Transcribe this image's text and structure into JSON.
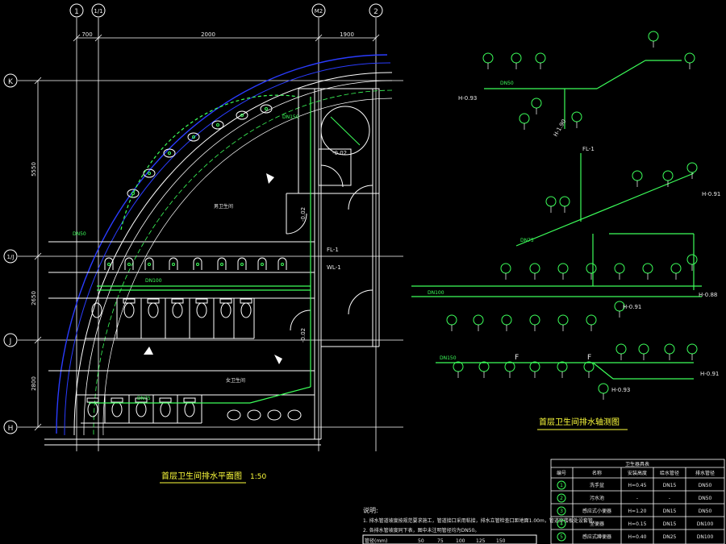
{
  "grid": {
    "columns": [
      "1",
      "1/1",
      "M2",
      "2"
    ],
    "rows": [
      "K",
      "1/J",
      "J",
      "H"
    ]
  },
  "dims": {
    "top": [
      "700",
      "2000",
      "1900"
    ],
    "left": [
      "5550",
      "2650",
      "2800"
    ]
  },
  "plan": {
    "title": "首层卫生间排水平面图",
    "scale": "1:50",
    "elev_labels": [
      "-0.02",
      "-0.02",
      "-0.02"
    ],
    "pipe_labels": [
      "FL-1",
      "WL-1",
      "DN100",
      "DN75",
      "DN50",
      "DN150"
    ],
    "room_labels": [
      "男卫生间",
      "女卫生间"
    ]
  },
  "iso": {
    "title": "首层卫生间排水轴测图",
    "elev_labels": [
      "H-0.93",
      "H-1.90",
      "H-0.91",
      "H-0.88",
      "H-0.91",
      "H-0.93",
      "H-0.91"
    ],
    "pipe_labels": [
      "FL-1",
      "DN100",
      "DN75",
      "DN50",
      "DN150",
      "F"
    ]
  },
  "notes": {
    "heading": "说明:",
    "lines": [
      "1. 排水管道坡度按规范要求施工，管道接口采用粘接，排水立管检查口距地面1.00m，管道穿楼板处设套管。",
      "2. 各排水管坡度同下表，图中未注明管径均为DN50。"
    ],
    "slope_row": [
      "管径(mm)",
      "50",
      "75",
      "100",
      "125",
      "150"
    ]
  },
  "legend_table": {
    "title": "卫生器具表",
    "headers": [
      "编号",
      "名称",
      "安装高度",
      "给水管径",
      "排水管径"
    ],
    "rows": [
      [
        "1",
        "洗手盆",
        "H=0.45",
        "DN15",
        "DN50"
      ],
      [
        "2",
        "污水池",
        "-",
        "-",
        "DN50"
      ],
      [
        "3",
        "感应式小便器",
        "H=1.20",
        "DN15",
        "DN50"
      ],
      [
        "4",
        "坐便器",
        "H=0.15",
        "DN15",
        "DN100"
      ],
      [
        "5",
        "感应式蹲便器",
        "H=0.40",
        "DN25",
        "DN100"
      ]
    ]
  },
  "colors": {
    "background": "#000000",
    "pipe": "#3cff5a",
    "wall": "#ffffff",
    "arc": "#2a3cff",
    "axis": "#ffffff"
  }
}
